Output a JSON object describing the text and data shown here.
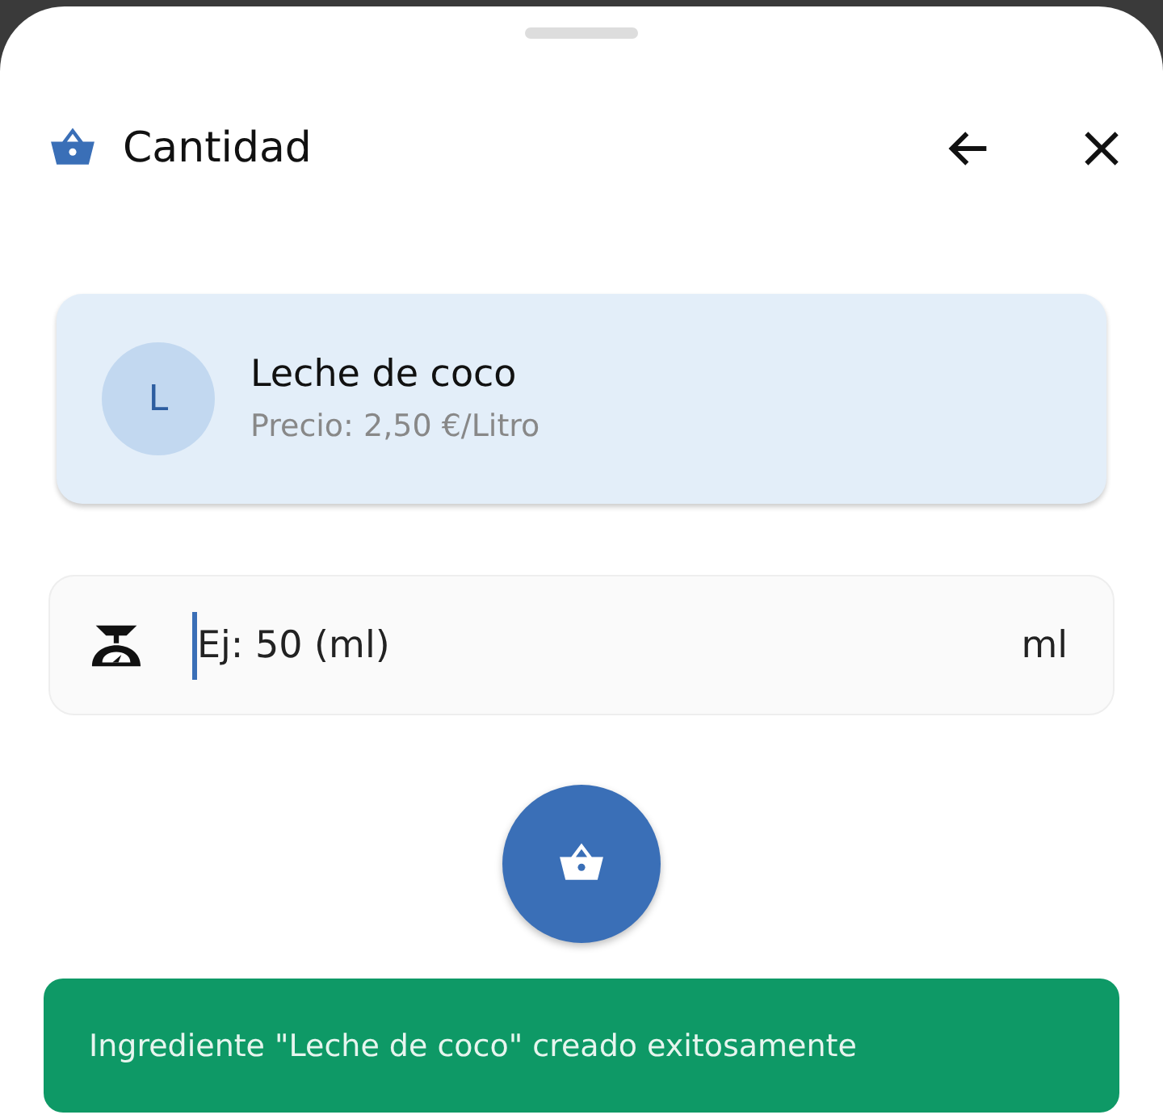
{
  "header": {
    "title": "Cantidad"
  },
  "ingredient": {
    "avatar": "L",
    "name": "Leche de coco",
    "price": "Precio: 2,50 €/Litro"
  },
  "quantity_field": {
    "placeholder": "Ej: 50 (ml)",
    "unit": "ml"
  },
  "snackbar": {
    "message": "Ingrediente \"Leche de coco\" creado exitosamente"
  }
}
